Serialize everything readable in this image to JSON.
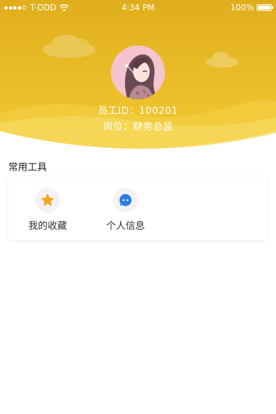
{
  "status_bar": {
    "carrier": "T-DDD",
    "time": "4:34 PM",
    "battery": "100%",
    "signal_bars": 4
  },
  "profile": {
    "id_line": "员工ID：100201",
    "position_line": "岗位：财务总监"
  },
  "tools_section": {
    "title": "常用工具",
    "items": [
      {
        "label": "我的收藏",
        "icon": "star-icon",
        "color": "#f5a623"
      },
      {
        "label": "个人信息",
        "icon": "chat-bubble-icon",
        "color": "#2f7de1"
      }
    ]
  },
  "colors": {
    "header_top": "#e2b31f",
    "header_bottom": "#f3cf3a",
    "wave_light": "#f7df6e"
  }
}
